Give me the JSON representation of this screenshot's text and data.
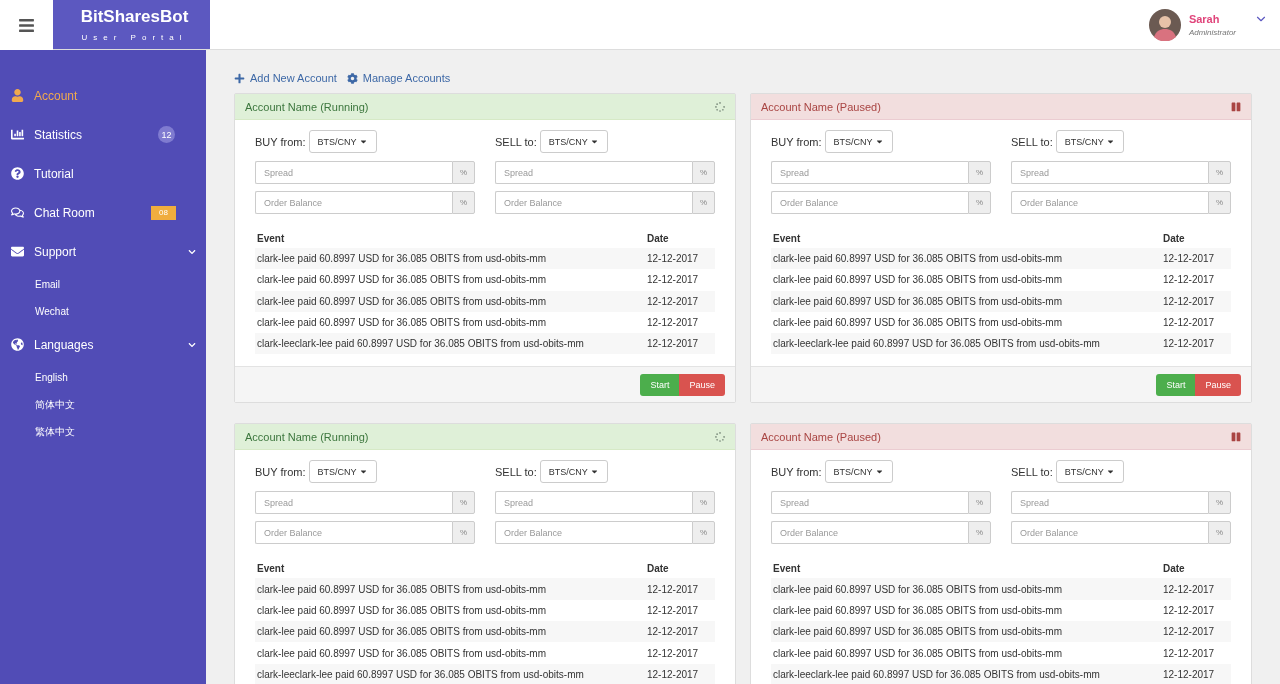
{
  "header": {
    "brand": "BitSharesBot",
    "subtitle": "User Portal",
    "user": {
      "name": "Sarah",
      "role": "Administrator"
    }
  },
  "sidebar": {
    "items": [
      {
        "label": "Account",
        "selected": true
      },
      {
        "label": "Statistics",
        "selected": false,
        "badge": {
          "text": "12",
          "kind": "circle"
        }
      },
      {
        "label": "Tutorial",
        "selected": false
      },
      {
        "label": "Chat Room",
        "selected": false,
        "badge": {
          "text": "08",
          "kind": "tag"
        }
      },
      {
        "label": "Support",
        "selected": false,
        "expanded": true,
        "children": [
          {
            "label": "Email"
          },
          {
            "label": "Wechat"
          }
        ]
      },
      {
        "label": "Languages",
        "selected": false,
        "expanded": true,
        "children": [
          {
            "label": "English"
          },
          {
            "label": "简体中文"
          },
          {
            "label": "繁体中文"
          }
        ]
      }
    ]
  },
  "actions": [
    "Add New Account",
    "Manage Accounts"
  ],
  "panels": [
    {
      "title": "Account Name (Running)",
      "running": true,
      "buy": {
        "label": "BUY from:",
        "pair": "BTS/CNY",
        "fields": [
          {
            "placeholder": "Spread",
            "unit": "%"
          },
          {
            "placeholder": "Order Balance",
            "unit": "%"
          }
        ]
      },
      "sell": {
        "label": "SELL to:",
        "pair": "BTS/CNY",
        "fields": [
          {
            "placeholder": "Spread",
            "unit": "%"
          },
          {
            "placeholder": "Order Balance",
            "unit": "%"
          }
        ]
      },
      "columns": [
        "Event",
        "Date"
      ],
      "rows": [
        {
          "event": "clark-lee paid 60.8997 USD for 36.085 OBITS from usd-obits-mm",
          "date": "12-12-2017"
        },
        {
          "event": "clark-lee paid 60.8997 USD for 36.085 OBITS from usd-obits-mm",
          "date": "12-12-2017"
        },
        {
          "event": "clark-lee paid 60.8997 USD for 36.085 OBITS from usd-obits-mm",
          "date": "12-12-2017"
        },
        {
          "event": "clark-lee paid 60.8997 USD for 36.085 OBITS from usd-obits-mm",
          "date": "12-12-2017"
        },
        {
          "event": "clark-leeclark-lee paid 60.8997 USD for 36.085 OBITS from usd-obits-mm",
          "date": "12-12-2017"
        }
      ],
      "buttons": [
        {
          "label": "Start",
          "kind": "start"
        },
        {
          "label": "Pause",
          "kind": "pause"
        }
      ]
    },
    {
      "title": "Account Name (Paused)",
      "running": false,
      "buy": {
        "label": "BUY from:",
        "pair": "BTS/CNY",
        "fields": [
          {
            "placeholder": "Spread",
            "unit": "%"
          },
          {
            "placeholder": "Order Balance",
            "unit": "%"
          }
        ]
      },
      "sell": {
        "label": "SELL to:",
        "pair": "BTS/CNY",
        "fields": [
          {
            "placeholder": "Spread",
            "unit": "%"
          },
          {
            "placeholder": "Order Balance",
            "unit": "%"
          }
        ]
      },
      "columns": [
        "Event",
        "Date"
      ],
      "rows": [
        {
          "event": "clark-lee paid 60.8997 USD for 36.085 OBITS from usd-obits-mm",
          "date": "12-12-2017"
        },
        {
          "event": "clark-lee paid 60.8997 USD for 36.085 OBITS from usd-obits-mm",
          "date": "12-12-2017"
        },
        {
          "event": "clark-lee paid 60.8997 USD for 36.085 OBITS from usd-obits-mm",
          "date": "12-12-2017"
        },
        {
          "event": "clark-lee paid 60.8997 USD for 36.085 OBITS from usd-obits-mm",
          "date": "12-12-2017"
        },
        {
          "event": "clark-leeclark-lee paid 60.8997 USD for 36.085 OBITS from usd-obits-mm",
          "date": "12-12-2017"
        }
      ],
      "buttons": [
        {
          "label": "Start",
          "kind": "start"
        },
        {
          "label": "Pause",
          "kind": "pause"
        }
      ]
    },
    {
      "title": "Account Name (Running)",
      "running": true,
      "buy": {
        "label": "BUY from:",
        "pair": "BTS/CNY",
        "fields": [
          {
            "placeholder": "Spread",
            "unit": "%"
          },
          {
            "placeholder": "Order Balance",
            "unit": "%"
          }
        ]
      },
      "sell": {
        "label": "SELL to:",
        "pair": "BTS/CNY",
        "fields": [
          {
            "placeholder": "Spread",
            "unit": "%"
          },
          {
            "placeholder": "Order Balance",
            "unit": "%"
          }
        ]
      },
      "columns": [
        "Event",
        "Date"
      ],
      "rows": [
        {
          "event": "clark-lee paid 60.8997 USD for 36.085 OBITS from usd-obits-mm",
          "date": "12-12-2017"
        },
        {
          "event": "clark-lee paid 60.8997 USD for 36.085 OBITS from usd-obits-mm",
          "date": "12-12-2017"
        },
        {
          "event": "clark-lee paid 60.8997 USD for 36.085 OBITS from usd-obits-mm",
          "date": "12-12-2017"
        },
        {
          "event": "clark-lee paid 60.8997 USD for 36.085 OBITS from usd-obits-mm",
          "date": "12-12-2017"
        },
        {
          "event": "clark-leeclark-lee paid 60.8997 USD for 36.085 OBITS from usd-obits-mm",
          "date": "12-12-2017"
        }
      ]
    },
    {
      "title": "Account Name (Paused)",
      "running": false,
      "buy": {
        "label": "BUY from:",
        "pair": "BTS/CNY",
        "fields": [
          {
            "placeholder": "Spread",
            "unit": "%"
          },
          {
            "placeholder": "Order Balance",
            "unit": "%"
          }
        ]
      },
      "sell": {
        "label": "SELL to:",
        "pair": "BTS/CNY",
        "fields": [
          {
            "placeholder": "Spread",
            "unit": "%"
          },
          {
            "placeholder": "Order Balance",
            "unit": "%"
          }
        ]
      },
      "columns": [
        "Event",
        "Date"
      ],
      "rows": [
        {
          "event": "clark-lee paid 60.8997 USD for 36.085 OBITS from usd-obits-mm",
          "date": "12-12-2017"
        },
        {
          "event": "clark-lee paid 60.8997 USD for 36.085 OBITS from usd-obits-mm",
          "date": "12-12-2017"
        },
        {
          "event": "clark-lee paid 60.8997 USD for 36.085 OBITS from usd-obits-mm",
          "date": "12-12-2017"
        },
        {
          "event": "clark-lee paid 60.8997 USD for 36.085 OBITS from usd-obits-mm",
          "date": "12-12-2017"
        },
        {
          "event": "clark-leeclark-lee paid 60.8997 USD for 36.085 OBITS from usd-obits-mm",
          "date": "12-12-2017"
        }
      ]
    }
  ]
}
